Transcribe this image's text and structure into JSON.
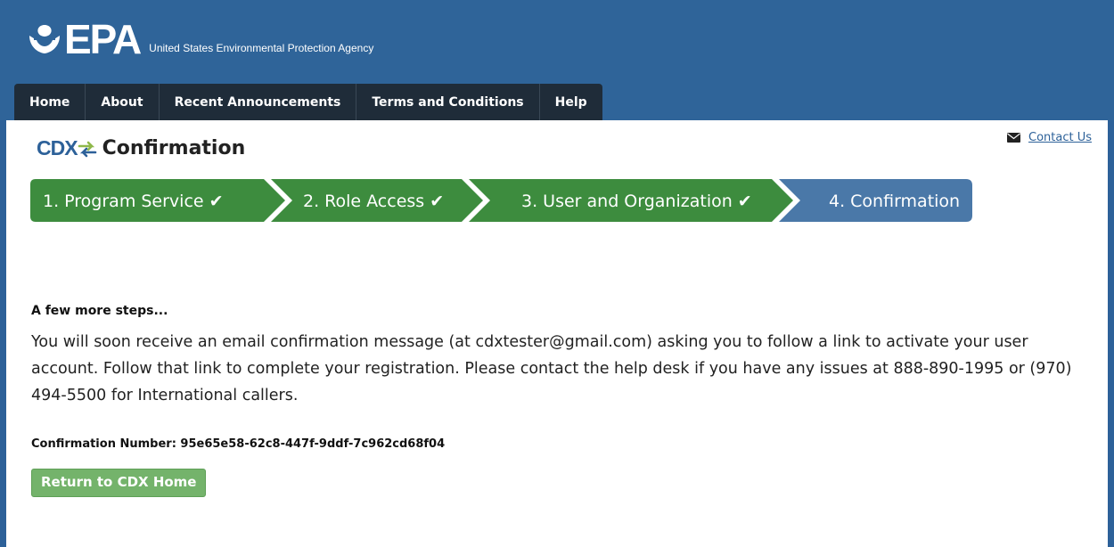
{
  "header": {
    "logo_text": "EPA",
    "agency_name": "United States Environmental Protection Agency",
    "brand_color": "#2f6499"
  },
  "nav": {
    "items": [
      {
        "label": "Home"
      },
      {
        "label": "About"
      },
      {
        "label": "Recent Announcements"
      },
      {
        "label": "Terms and Conditions"
      },
      {
        "label": "Help"
      }
    ]
  },
  "contact": {
    "icon": "envelope-icon",
    "label": "Contact Us"
  },
  "page": {
    "logo_text": "CDX",
    "title": "Confirmation"
  },
  "steps": {
    "items": [
      {
        "label": "1. Program Service ✔",
        "status": "complete",
        "color": "#3d8c3e"
      },
      {
        "label": "2. Role Access ✔",
        "status": "complete",
        "color": "#3d8c3e"
      },
      {
        "label": "3. User and Organization ✔",
        "status": "complete",
        "color": "#3d8c3e"
      },
      {
        "label": "4. Confirmation",
        "status": "current",
        "color": "#4a78a8"
      }
    ]
  },
  "message": {
    "heading": "A few more steps...",
    "body": "You will soon receive an email confirmation message (at cdxtester@gmail.com) asking you to follow a link to activate your user account. Follow that link to complete your registration. Please contact the help desk if you have any issues at 888-890-1995 or (970) 494-5500 for International callers.",
    "confirmation_label": "Confirmation Number:",
    "confirmation_number": "95e65e58-62c8-447f-9ddf-7c962cd68f04"
  },
  "actions": {
    "return_label": "Return to CDX Home",
    "button_color": "#74b36b"
  }
}
